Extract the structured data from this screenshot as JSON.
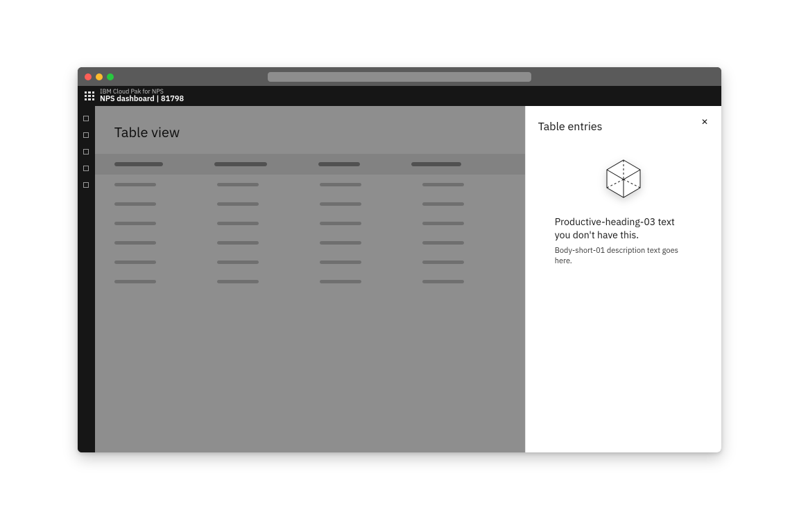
{
  "header": {
    "product_line": "IBM Cloud Pak for NPS",
    "page_name": "NPS dashboard | 81798"
  },
  "sidebar": {
    "items": [
      {
        "id": "nav-1"
      },
      {
        "id": "nav-2"
      },
      {
        "id": "nav-3"
      },
      {
        "id": "nav-4"
      },
      {
        "id": "nav-5"
      }
    ]
  },
  "main": {
    "title": "Table view"
  },
  "side_panel": {
    "title": "Table entries",
    "close_label": "✕",
    "empty_state": {
      "heading": "Productive-heading-03 text you don't have this.",
      "description": "Body-short-01 description text goes here."
    }
  }
}
